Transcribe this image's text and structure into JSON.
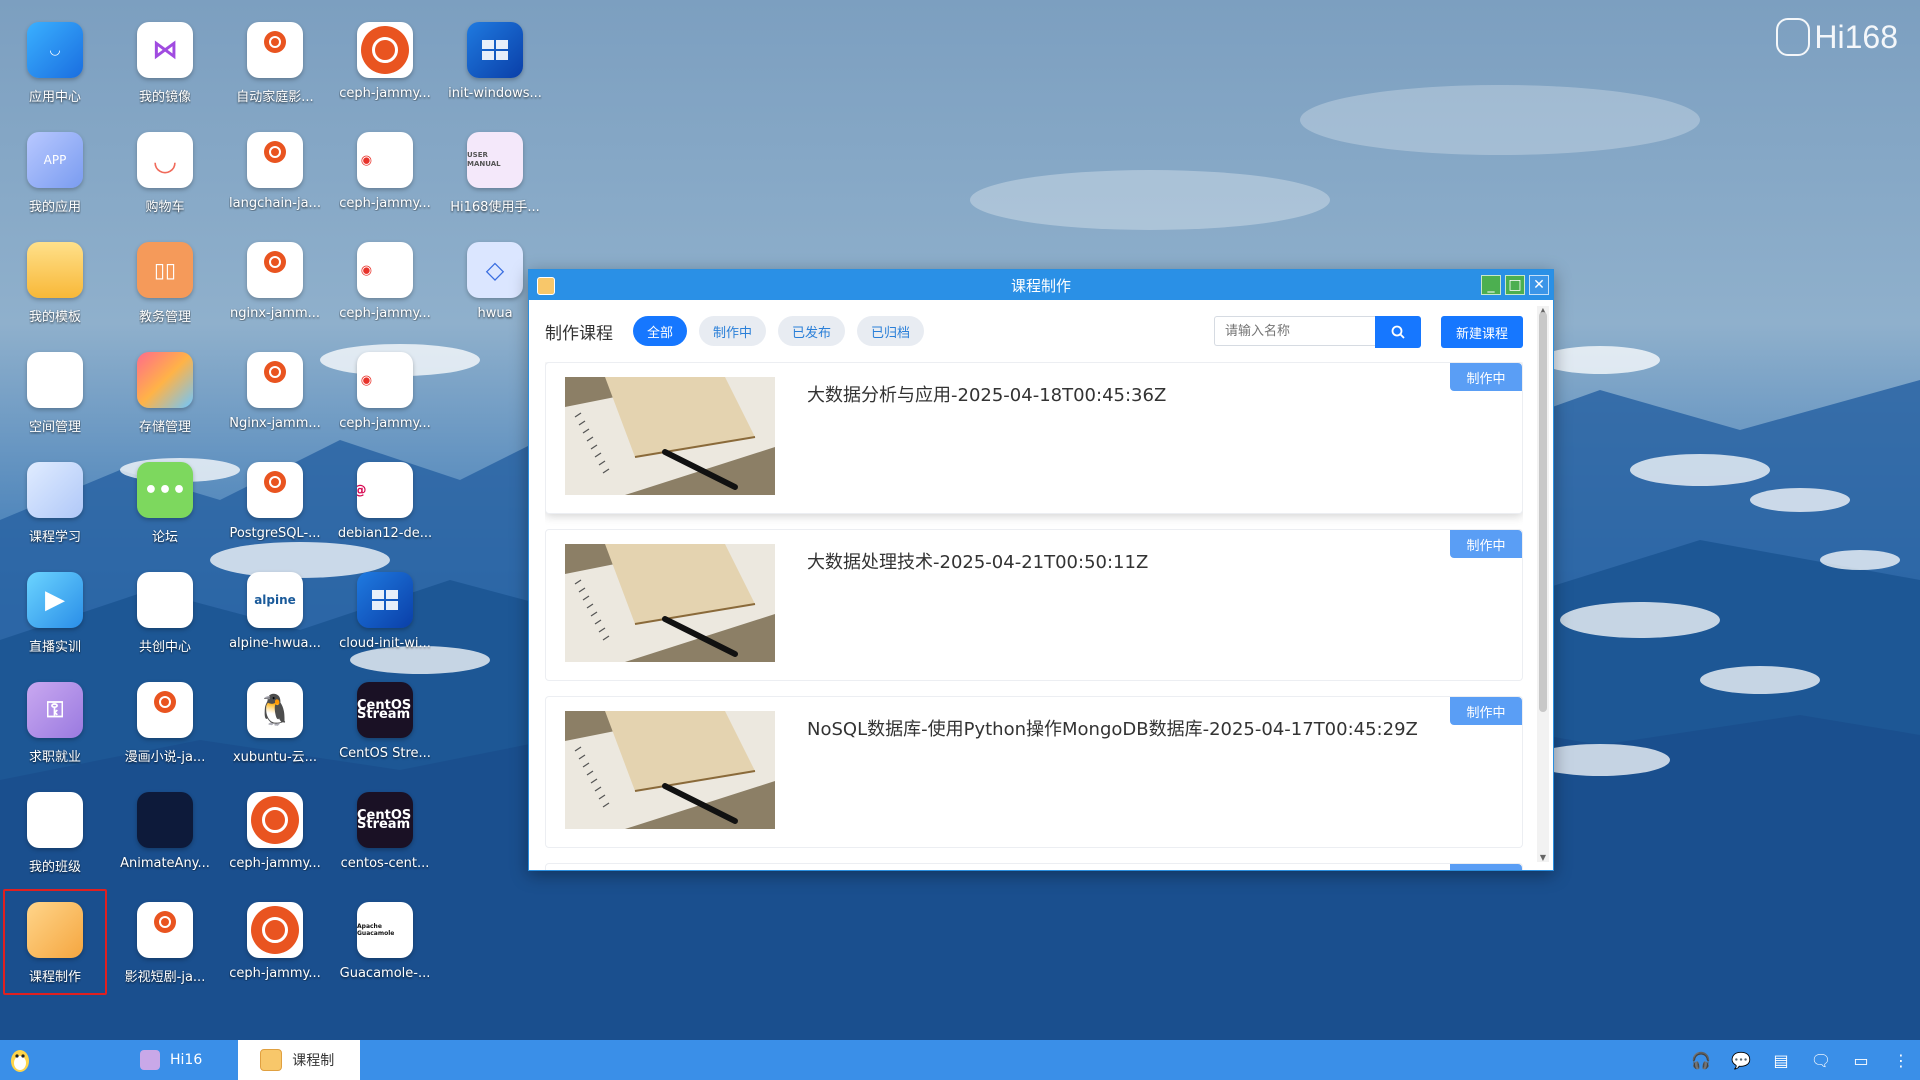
{
  "brand": {
    "name": "Hi168"
  },
  "desktop": {
    "icons": [
      {
        "label": "应用中心",
        "kind": "app-center"
      },
      {
        "label": "我的镜像",
        "kind": "mirror"
      },
      {
        "label": "自动家庭影...",
        "kind": "ubuntu"
      },
      {
        "label": "ceph-jammy...",
        "kind": "ubuntu-big"
      },
      {
        "label": "init-windows...",
        "kind": "windows"
      },
      {
        "label": "我的应用",
        "kind": "my-app",
        "text": "APP"
      },
      {
        "label": "购物车",
        "kind": "cart"
      },
      {
        "label": "langchain-ja...",
        "kind": "ubuntu"
      },
      {
        "label": "ceph-jammy...",
        "kind": "ceph",
        "text": "ceph"
      },
      {
        "label": "Hi168使用手...",
        "kind": "manual",
        "text": "USER MANUAL"
      },
      {
        "label": "我的模板",
        "kind": "folder"
      },
      {
        "label": "教务管理",
        "kind": "edu"
      },
      {
        "label": "nginx-jamm...",
        "kind": "ubuntu"
      },
      {
        "label": "ceph-jammy...",
        "kind": "ceph",
        "text": "ceph"
      },
      {
        "label": "hwua",
        "kind": "hwua"
      },
      {
        "label": "空间管理",
        "kind": "space"
      },
      {
        "label": "存储管理",
        "kind": "storage"
      },
      {
        "label": "Nginx-jamm...",
        "kind": "ubuntu"
      },
      {
        "label": "ceph-jammy...",
        "kind": "ceph",
        "text": "ceph"
      },
      {
        "label": "课程学习",
        "kind": "course-learn"
      },
      {
        "label": "论坛",
        "kind": "forum"
      },
      {
        "label": "PostgreSQL-...",
        "kind": "ubuntu"
      },
      {
        "label": "debian12-de...",
        "kind": "debian",
        "text": "debian"
      },
      {
        "label": "直播实训",
        "kind": "live"
      },
      {
        "label": "共创中心",
        "kind": "cocreate"
      },
      {
        "label": "alpine-hwua...",
        "kind": "alpine",
        "text": "alpine"
      },
      {
        "label": "cloud-init-wi...",
        "kind": "windows"
      },
      {
        "label": "求职就业",
        "kind": "job"
      },
      {
        "label": "漫画小说-ja...",
        "kind": "ubuntu"
      },
      {
        "label": "xubuntu-云...",
        "kind": "tux"
      },
      {
        "label": "CentOS Stre...",
        "kind": "centos",
        "text": "CentOS Stream"
      },
      {
        "label": "我的班级",
        "kind": "class"
      },
      {
        "label": "AnimateAny...",
        "kind": "animate"
      },
      {
        "label": "ceph-jammy...",
        "kind": "ubuntu-big"
      },
      {
        "label": "centos-cent...",
        "kind": "centos",
        "text": "CentOS Stream"
      },
      {
        "label": "课程制作",
        "kind": "course-make"
      },
      {
        "label": "影视短剧-ja...",
        "kind": "ubuntu"
      },
      {
        "label": "ceph-jammy...",
        "kind": "ubuntu-big"
      },
      {
        "label": "Guacamole-...",
        "kind": "guac",
        "text": "Apache Guacamole"
      }
    ]
  },
  "window": {
    "title": "课程制作",
    "controls": {
      "minimize": "_",
      "maximize": "□",
      "close": "✕"
    },
    "heading": "制作课程",
    "filters": [
      "全部",
      "制作中",
      "已发布",
      "已归档"
    ],
    "active_filter": "全部",
    "search": {
      "placeholder": "请输入名称",
      "value": ""
    },
    "new_button": "新建课程",
    "courses": [
      {
        "title": "大数据分析与应用-2025-04-18T00:45:36Z",
        "status": "制作中"
      },
      {
        "title": "大数据处理技术-2025-04-21T00:50:11Z",
        "status": "制作中"
      },
      {
        "title": "NoSQL数据库-使用Python操作MongoDB数据库-2025-04-17T00:45:29Z",
        "status": "制作中"
      }
    ]
  },
  "taskbar": {
    "items": [
      {
        "label": "Hi16",
        "active": false
      },
      {
        "label": "课程制",
        "active": true
      }
    ],
    "tray": [
      "headset-icon",
      "wechat-icon",
      "notes-icon",
      "chat-icon",
      "monitor-icon",
      "more-icon"
    ]
  },
  "colors": {
    "accent": "#1677ff",
    "titlebar": "#2a90e6",
    "taskbar": "#3a8fe8",
    "badge": "#5a9ef5",
    "ubuntu": "#e95420"
  }
}
